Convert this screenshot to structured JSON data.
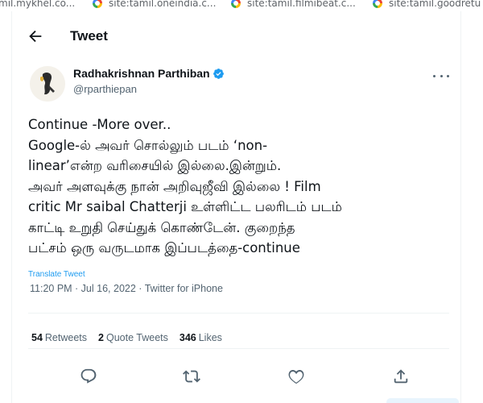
{
  "bookmarks": [
    {
      "label": "mil.mykhel.co..."
    },
    {
      "label": "site:tamil.oneindia.c..."
    },
    {
      "label": "site:tamil.filmibeat.c..."
    },
    {
      "label": "site:tamil.goodretu"
    }
  ],
  "header": {
    "title": "Tweet"
  },
  "author": {
    "name": "Radhakrishnan Parthiban",
    "handle": "@rparthiepan"
  },
  "tweet": {
    "lines": [
      "Continue -More over..",
      "Google-ல் அவர் சொல்லும் படம் ‘non-",
      "linear’என்ற வரிசையில் இல்லை.இன்றும்.",
      "அவர் அளவுக்கு நான் அறிவுஜீவி இல்லை ! Film",
      "critic Mr saibal Chatterji உள்ளிட்ட பலரிடம் படம்",
      "காட்டி உறுதி செய்துக் கொண்டேன். குறைந்த",
      "பட்சம் ஒரு வருடமாக இப்படத்தை-continue"
    ],
    "translate_label": "Translate Tweet",
    "time": "11:20 PM · Jul 16, 2022 · ",
    "source": "Twitter for iPhone"
  },
  "stats": {
    "retweets_count": "54",
    "retweets_label": "Retweets",
    "quotes_count": "2",
    "quotes_label": "Quote Tweets",
    "likes_count": "346",
    "likes_label": "Likes"
  },
  "colors": {
    "accent": "#1d9bf0",
    "text": "#0f1419",
    "secondary": "#536471"
  }
}
